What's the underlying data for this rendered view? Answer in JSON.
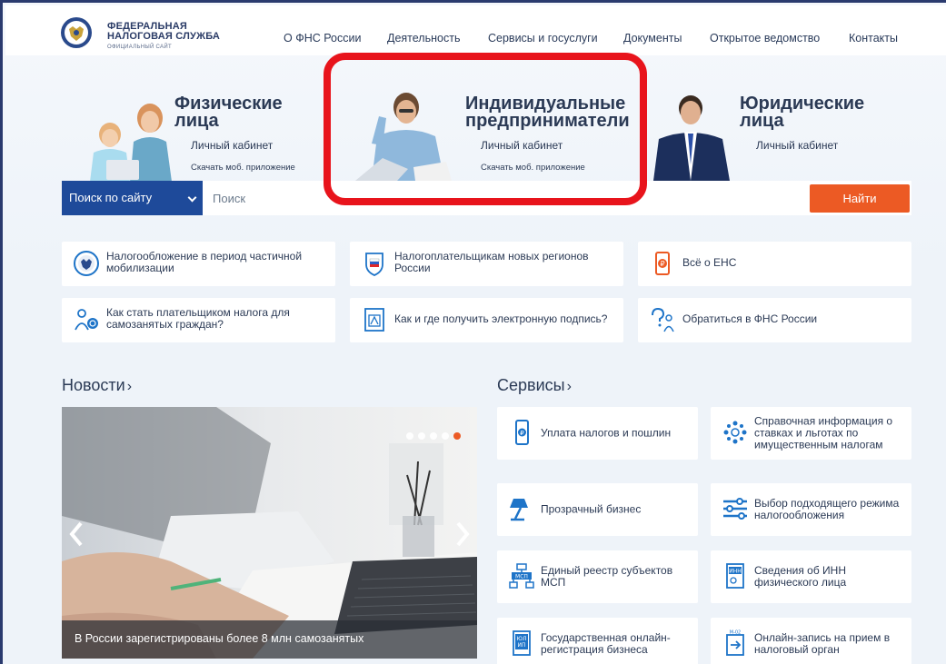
{
  "header": {
    "logo_line1": "ФЕДЕРАЛЬНАЯ",
    "logo_line2": "НАЛОГОВАЯ СЛУЖБА",
    "logo_line3": "ОФИЦИАЛЬНЫЙ САЙТ",
    "nav": [
      "О ФНС России",
      "Деятельность",
      "Сервисы и госуслуги",
      "Документы",
      "Открытое ведомство",
      "Контакты"
    ]
  },
  "hero": {
    "individuals": {
      "title1": "Физические",
      "title2": "лица",
      "link1": "Личный кабинет",
      "link2": "Скачать моб. приложение"
    },
    "entrepreneurs": {
      "title1": "Индивидуальные",
      "title2": "предприниматели",
      "link1": "Личный кабинет",
      "link2": "Скачать моб. приложение"
    },
    "legal": {
      "title1": "Юридические",
      "title2": "лица",
      "link1": "Личный кабинет"
    }
  },
  "search": {
    "scope_label": "Поиск по сайту",
    "placeholder": "Поиск",
    "button": "Найти"
  },
  "quick_links": [
    "Налогообложение в период частичной мобилизации",
    "Налогоплательщикам новых регионов России",
    "Всё о ЕНС",
    "Как стать плательщиком налога для самозанятых граждан?",
    "Как и где получить электронную подпись?",
    "Обратиться в ФНС России"
  ],
  "news": {
    "title": "Новости",
    "arrow": "›",
    "caption": "В России зарегистрированы более 8 млн самозанятых",
    "slides_total": 5,
    "slide_active": 5
  },
  "services": {
    "title": "Сервисы",
    "arrow": "›",
    "items": [
      "Уплата налогов и пошлин",
      "Справочная информация о ставках и льготах по имущественным налогам",
      "Прозрачный бизнес",
      "Выбор подходящего режима налогообложения",
      "Единый реестр субъектов МСП",
      "Сведения об ИНН физического лица",
      "Государственная онлайн-регистрация бизнеса",
      "Онлайн-запись на прием в налоговый орган"
    ]
  },
  "icon_labels": {
    "ens": "₽",
    "inn": "ИНН",
    "msp": "МСП",
    "ul_ip_top": "ЮЛ",
    "ul_ip_bottom": "ИП",
    "m02": "М-02"
  },
  "colors": {
    "accent_orange": "#ec5a24",
    "brand_blue": "#1e4a9a",
    "highlight_red": "#e8141c",
    "icon_blue": "#1e74c8"
  }
}
